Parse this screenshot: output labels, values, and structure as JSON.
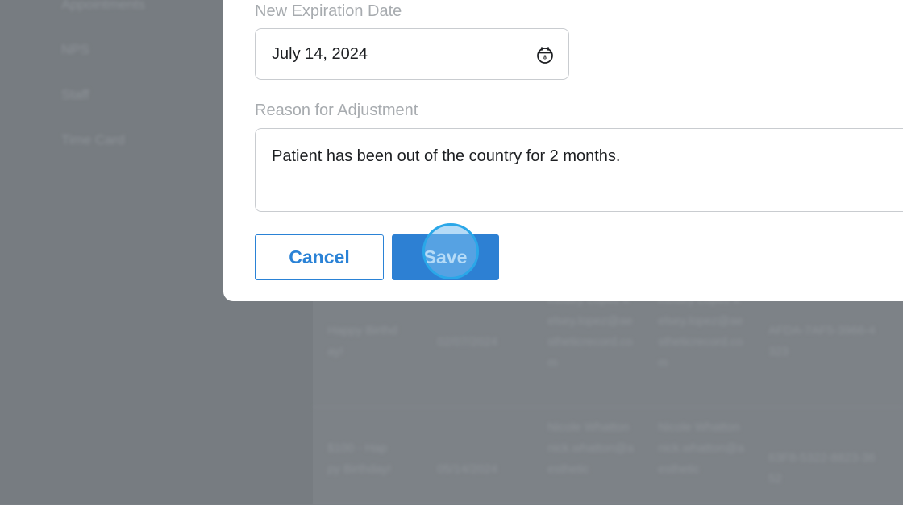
{
  "background": {
    "sidebar_items": [
      "Appointments",
      "NPS",
      "Staff",
      "Time Card"
    ],
    "table_rows": [
      {
        "name": "Happy Birthday!",
        "date": "02/07/2024",
        "issued_by": "Kelsey Lopez kelsey.lopez@aestheticrecord.com",
        "assigned_to": "Kelsey Lopez kelsey.lopez@aestheticrecord.com",
        "code": "AFDA-7AF5-3966-4323"
      },
      {
        "name": "$100 - Happy Birthday!",
        "date": "05/14/2024",
        "issued_by": "Nicole Whatton nick.whatton@aesthetic",
        "assigned_to": "Nicole Whatton nick.whatton@aesthetic",
        "code": "63F8-5322-8823-3652"
      }
    ]
  },
  "modal": {
    "expiration": {
      "label": "New Expiration Date",
      "value": "July 14, 2024",
      "calendar_icon": "calendar-icon"
    },
    "reason": {
      "label": "Reason for Adjustment",
      "value": "Patient has been out of the country for 2 months."
    },
    "actions": {
      "cancel_label": "Cancel",
      "save_label": "Save"
    }
  },
  "colors": {
    "accent": "#2d80d3",
    "overlay": "#7a7f84",
    "click_indicator": "#2aa7e8"
  }
}
